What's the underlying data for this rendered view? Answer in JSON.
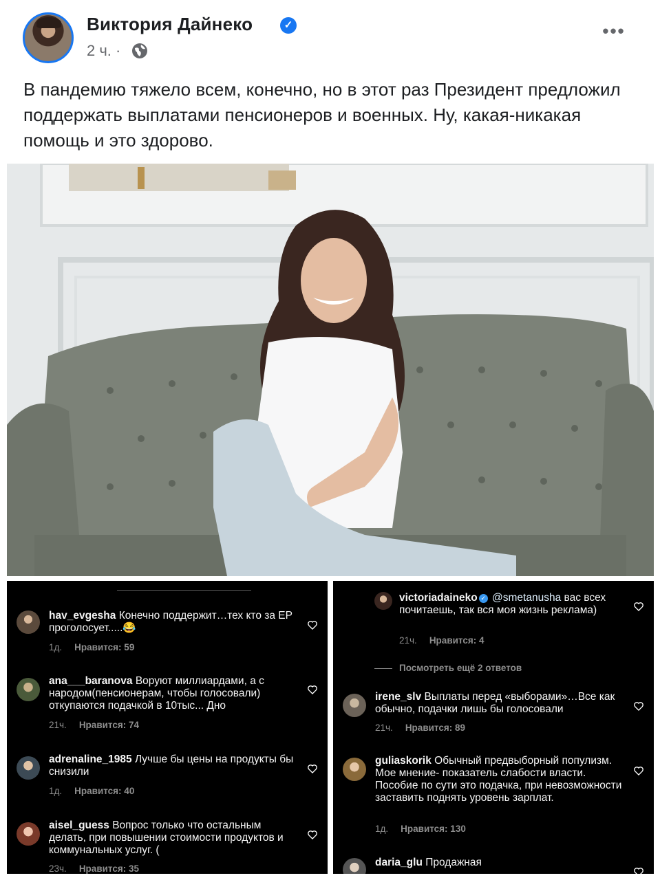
{
  "post": {
    "author": "Виктория Дайнеко",
    "verified_glyph": "✓",
    "time": "2 ч. ·",
    "more_glyph": "•••",
    "text": "В пандемию тяжело всем, конечно, но в этот раз Президент предложил поддержать выплатами пенсионеров и военных. Ну, какая-никакая помощь и это здорово."
  },
  "comments_left": [
    {
      "username": "hav_evgesha",
      "text": "Конечно поддержит…тех кто за ЕР проголосует.....😂",
      "time": "1д.",
      "likes": "Нравится: 59"
    },
    {
      "username": "ana___baranova",
      "text": "Воруют миллиардами, а с народом(пенсионерам, чтобы голосовали) откупаются подачкой в 10тыс... Дно",
      "time": "21ч.",
      "likes": "Нравится: 74"
    },
    {
      "username": "adrenaline_1985",
      "text": "Лучше бы цены на продукты бы снизили",
      "time": "1д.",
      "likes": "Нравится: 40"
    },
    {
      "username": "aisel_guess",
      "text": "Вопрос только что остальным делать, при повышении стоимости продуктов и коммунальных услуг. (",
      "time": "23ч.",
      "likes": "Нравится: 35"
    }
  ],
  "comments_right": {
    "reply": {
      "username": "victoriadaineko",
      "mention": "@smetanusha",
      "text": "вас всех почитаешь, так вся моя жизнь реклама)",
      "time": "21ч.",
      "likes": "Нравится: 4"
    },
    "view_more": "Посмотреть ещё 2 ответов",
    "items": [
      {
        "username": "irene_slv",
        "text": "Выплаты перед «выборами»…Все как обычно, подачки лишь бы голосовали",
        "time": "21ч.",
        "likes": "Нравится: 89"
      },
      {
        "username": "guliaskorik",
        "text": "Обычный предвыборный популизм. Мое мнение- показатель слабости власти. Пособие по сути это подачка, при невозможности заставить поднять уровень зарплат.",
        "time": "1д.",
        "likes": "Нравится: 130"
      },
      {
        "username": "daria_glu",
        "text": "Продажная"
      }
    ]
  },
  "icons": {
    "globe": "globe-icon",
    "heart": "heart-icon",
    "more": "more-options-icon",
    "verified": "verified-badge-icon"
  },
  "colors": {
    "facebook_blue": "#1877f2",
    "instagram_badge": "#3897f0",
    "panel_bg": "#000000",
    "meta_gray": "#8e8e8e"
  }
}
